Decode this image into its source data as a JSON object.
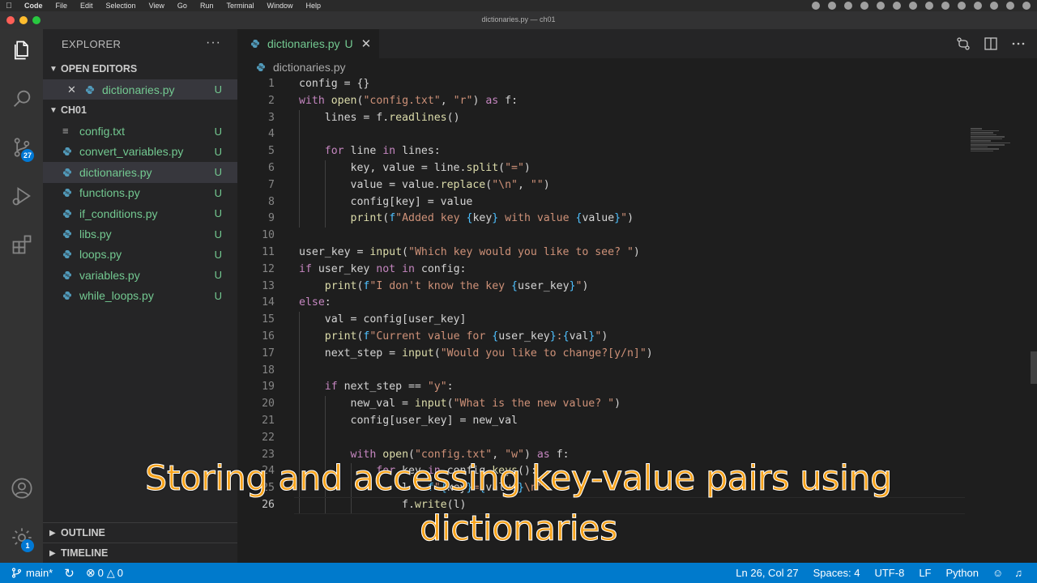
{
  "menubar": {
    "app": "Code",
    "items": [
      "File",
      "Edit",
      "Selection",
      "View",
      "Go",
      "Run",
      "Terminal",
      "Window",
      "Help"
    ]
  },
  "window": {
    "title": "dictionaries.py — ch01"
  },
  "activity_bar": {
    "scm_badge": "27",
    "settings_badge": "1",
    "icons": [
      "files-icon",
      "search-icon",
      "source-control-icon",
      "run-debug-icon",
      "extensions-icon",
      "account-icon",
      "settings-gear-icon"
    ]
  },
  "sidebar": {
    "header": "EXPLORER",
    "more_actions": "···",
    "open_editors_label": "OPEN EDITORS",
    "open_editors": [
      {
        "name": "dictionaries.py",
        "status": "U"
      }
    ],
    "folder_label": "CH01",
    "files": [
      {
        "name": "config.txt",
        "status": "U",
        "icon": "text-file-icon"
      },
      {
        "name": "convert_variables.py",
        "status": "U",
        "icon": "python-file-icon"
      },
      {
        "name": "dictionaries.py",
        "status": "U",
        "icon": "python-file-icon"
      },
      {
        "name": "functions.py",
        "status": "U",
        "icon": "python-file-icon"
      },
      {
        "name": "if_conditions.py",
        "status": "U",
        "icon": "python-file-icon"
      },
      {
        "name": "libs.py",
        "status": "U",
        "icon": "python-file-icon"
      },
      {
        "name": "loops.py",
        "status": "U",
        "icon": "python-file-icon"
      },
      {
        "name": "variables.py",
        "status": "U",
        "icon": "python-file-icon"
      },
      {
        "name": "while_loops.py",
        "status": "U",
        "icon": "python-file-icon"
      }
    ],
    "outline_label": "OUTLINE",
    "timeline_label": "TIMELINE"
  },
  "editor": {
    "tab": {
      "name": "dictionaries.py",
      "status": "U"
    },
    "breadcrumb": "dictionaries.py",
    "lines": [
      {
        "n": "1",
        "tokens": [
          [
            "",
            "config = {}"
          ]
        ]
      },
      {
        "n": "2",
        "tokens": [
          [
            "kw",
            "with"
          ],
          [
            "",
            " "
          ],
          [
            "fn",
            "open"
          ],
          [
            "",
            "("
          ],
          [
            "st",
            "\"config.txt\""
          ],
          [
            "",
            ", "
          ],
          [
            "st",
            "\"r\""
          ],
          [
            "",
            ") "
          ],
          [
            "kw",
            "as"
          ],
          [
            "",
            " f:"
          ]
        ]
      },
      {
        "n": "3",
        "tokens": [
          [
            "",
            "    lines = f."
          ],
          [
            "fn",
            "readlines"
          ],
          [
            "",
            "()"
          ]
        ]
      },
      {
        "n": "4",
        "tokens": [
          [
            "",
            ""
          ]
        ]
      },
      {
        "n": "5",
        "tokens": [
          [
            "",
            "    "
          ],
          [
            "kw",
            "for"
          ],
          [
            "",
            " line "
          ],
          [
            "kw",
            "in"
          ],
          [
            "",
            " lines:"
          ]
        ]
      },
      {
        "n": "6",
        "tokens": [
          [
            "",
            "        key, value = line."
          ],
          [
            "fn",
            "split"
          ],
          [
            "",
            "("
          ],
          [
            "st",
            "\"=\""
          ],
          [
            "",
            ")"
          ]
        ]
      },
      {
        "n": "7",
        "tokens": [
          [
            "",
            "        value = value."
          ],
          [
            "fn",
            "replace"
          ],
          [
            "",
            "("
          ],
          [
            "st",
            "\"\\n\""
          ],
          [
            "",
            ", "
          ],
          [
            "st",
            "\"\""
          ],
          [
            "",
            ")"
          ]
        ]
      },
      {
        "n": "8",
        "tokens": [
          [
            "",
            "        config[key] = value"
          ]
        ]
      },
      {
        "n": "9",
        "tokens": [
          [
            "",
            "        "
          ],
          [
            "fn",
            "print"
          ],
          [
            "",
            "("
          ],
          [
            "fv",
            "f"
          ],
          [
            "st",
            "\"Added key "
          ],
          [
            "fv",
            "{"
          ],
          [
            "",
            "key"
          ],
          [
            "fv",
            "}"
          ],
          [
            "st",
            " with value "
          ],
          [
            "fv",
            "{"
          ],
          [
            "",
            "value"
          ],
          [
            "fv",
            "}"
          ],
          [
            "st",
            "\""
          ],
          [
            "",
            ")"
          ]
        ]
      },
      {
        "n": "10",
        "tokens": [
          [
            "",
            ""
          ]
        ]
      },
      {
        "n": "11",
        "tokens": [
          [
            "",
            "user_key = "
          ],
          [
            "fn",
            "input"
          ],
          [
            "",
            "("
          ],
          [
            "st",
            "\"Which key would you like to see? \""
          ],
          [
            "",
            ")"
          ]
        ]
      },
      {
        "n": "12",
        "tokens": [
          [
            "kw",
            "if"
          ],
          [
            "",
            " user_key "
          ],
          [
            "kw",
            "not in"
          ],
          [
            "",
            " config:"
          ]
        ]
      },
      {
        "n": "13",
        "tokens": [
          [
            "",
            "    "
          ],
          [
            "fn",
            "print"
          ],
          [
            "",
            "("
          ],
          [
            "fv",
            "f"
          ],
          [
            "st",
            "\"I don't know the key "
          ],
          [
            "fv",
            "{"
          ],
          [
            "",
            "user_key"
          ],
          [
            "fv",
            "}"
          ],
          [
            "st",
            "\""
          ],
          [
            "",
            ")"
          ]
        ]
      },
      {
        "n": "14",
        "tokens": [
          [
            "kw",
            "else"
          ],
          [
            "",
            ":"
          ]
        ]
      },
      {
        "n": "15",
        "tokens": [
          [
            "",
            "    val = config[user_key]"
          ]
        ]
      },
      {
        "n": "16",
        "tokens": [
          [
            "",
            "    "
          ],
          [
            "fn",
            "print"
          ],
          [
            "",
            "("
          ],
          [
            "fv",
            "f"
          ],
          [
            "st",
            "\"Current value for "
          ],
          [
            "fv",
            "{"
          ],
          [
            "",
            "user_key"
          ],
          [
            "fv",
            "}"
          ],
          [
            "st",
            ":"
          ],
          [
            "fv",
            "{"
          ],
          [
            "",
            "val"
          ],
          [
            "fv",
            "}"
          ],
          [
            "st",
            "\""
          ],
          [
            "",
            ")"
          ]
        ]
      },
      {
        "n": "17",
        "tokens": [
          [
            "",
            "    next_step = "
          ],
          [
            "fn",
            "input"
          ],
          [
            "",
            "("
          ],
          [
            "st",
            "\"Would you like to change?[y/n]\""
          ],
          [
            "",
            ")"
          ]
        ]
      },
      {
        "n": "18",
        "tokens": [
          [
            "",
            ""
          ]
        ]
      },
      {
        "n": "19",
        "tokens": [
          [
            "",
            "    "
          ],
          [
            "kw",
            "if"
          ],
          [
            "",
            " next_step == "
          ],
          [
            "st",
            "\"y\""
          ],
          [
            "",
            ":"
          ]
        ]
      },
      {
        "n": "20",
        "tokens": [
          [
            "",
            "        new_val = "
          ],
          [
            "fn",
            "input"
          ],
          [
            "",
            "("
          ],
          [
            "st",
            "\"What is the new value? \""
          ],
          [
            "",
            ")"
          ]
        ]
      },
      {
        "n": "21",
        "tokens": [
          [
            "",
            "        config[user_key] = new_val"
          ]
        ]
      },
      {
        "n": "22",
        "tokens": [
          [
            "",
            ""
          ]
        ]
      },
      {
        "n": "23",
        "tokens": [
          [
            "",
            "        "
          ],
          [
            "kw",
            "with"
          ],
          [
            "",
            " "
          ],
          [
            "fn",
            "open"
          ],
          [
            "",
            "("
          ],
          [
            "st",
            "\"config.txt\""
          ],
          [
            "",
            ", "
          ],
          [
            "st",
            "\"w\""
          ],
          [
            "",
            ") "
          ],
          [
            "kw",
            "as"
          ],
          [
            "",
            " f:"
          ]
        ]
      },
      {
        "n": "24",
        "tokens": [
          [
            "",
            "            "
          ],
          [
            "kw",
            "for"
          ],
          [
            "",
            " key "
          ],
          [
            "kw",
            "in"
          ],
          [
            "",
            " config."
          ],
          [
            "fn",
            "keys"
          ],
          [
            "",
            "():"
          ]
        ]
      },
      {
        "n": "25",
        "tokens": [
          [
            "",
            "                l = "
          ],
          [
            "fv",
            "f"
          ],
          [
            "st",
            "\""
          ],
          [
            "fv",
            "{"
          ],
          [
            "",
            "key"
          ],
          [
            "fv",
            "}"
          ],
          [
            "st",
            "="
          ],
          [
            "fv",
            "{"
          ],
          [
            "",
            "value"
          ],
          [
            "fv",
            "}"
          ],
          [
            "st",
            "\\n\""
          ]
        ]
      },
      {
        "n": "26",
        "tokens": [
          [
            "",
            "                f."
          ],
          [
            "fn",
            "write"
          ],
          [
            "",
            "(l)"
          ]
        ]
      }
    ]
  },
  "status_bar": {
    "branch": "main*",
    "errors": "0",
    "warnings": "0",
    "position": "Ln 26, Col 27",
    "indent": "Spaces: 4",
    "encoding": "UTF-8",
    "eol": "LF",
    "language": "Python"
  },
  "caption": {
    "line1": "Storing and accessing key-value pairs using",
    "line2": "dictionaries"
  }
}
